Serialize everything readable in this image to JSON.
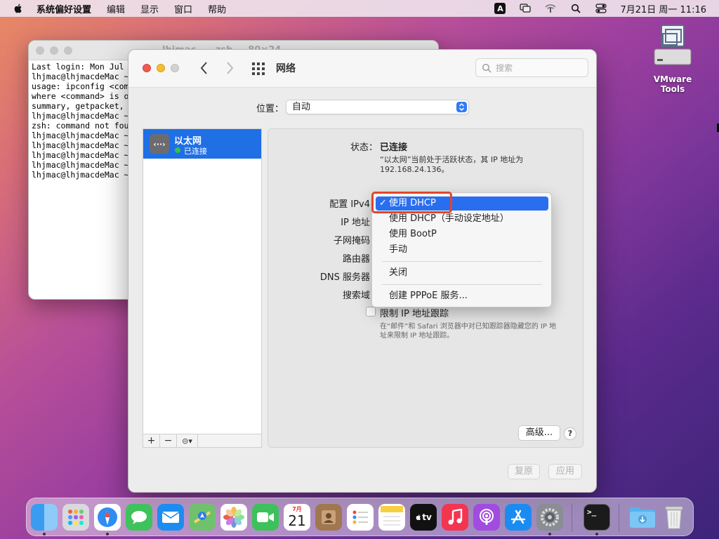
{
  "menubar": {
    "app_name": "系统偏好设置",
    "items": [
      "编辑",
      "显示",
      "窗口",
      "帮助"
    ],
    "input_method": "A",
    "clock": "7月21日 周一  11:16"
  },
  "desktop": {
    "vmware_label": "VMware Tools"
  },
  "terminal": {
    "title": "lhjmac — -zsh — 80×24",
    "lines": [
      "Last login: Mon Jul",
      "lhjmac@lhjmacdeMac ~",
      "usage: ipconfig <com",
      "where <command> is o",
      "summary, getpacket,",
      "lhjmac@lhjmacdeMac ~",
      "zsh: command not fou",
      "lhjmac@lhjmacdeMac ~",
      "lhjmac@lhjmacdeMac ~",
      "lhjmac@lhjmacdeMac ~",
      "lhjmac@lhjmacdeMac ~",
      "lhjmac@lhjmacdeMac ~"
    ]
  },
  "window": {
    "title": "网络",
    "search_placeholder": "搜索",
    "location_label": "位置：",
    "location_value": "自动",
    "service": {
      "name": "以太网",
      "status": "已连接",
      "icon_text": "‹··›"
    },
    "sidebar_buttons": [
      "+",
      "−",
      "⊝▾"
    ],
    "status_label": "状态：",
    "status_value": "已连接",
    "status_desc": "“以太网”当前处于活跃状态，其 IP 地址为 192.168.24.136。",
    "fields": {
      "configure_ipv4": "配置 IPv4",
      "ip_address": "IP 地址",
      "subnet_mask": "子网掩码",
      "router": "路由器",
      "dns_server": "DNS 服务器",
      "search_domains": "搜索域"
    },
    "limit_ip_tracking": "限制 IP 地址跟踪",
    "limit_ip_tracking_desc": "在“邮件”和 Safari 浏览器中对已知跟踪器隐藏您的 IP 地址来限制 IP 地址跟踪。",
    "advanced_button": "高级...",
    "help_button": "?",
    "revert_button": "复原",
    "apply_button": "应用"
  },
  "dropdown": {
    "check": "✓",
    "items": [
      "使用 DHCP",
      "使用 DHCP（手动设定地址）",
      "使用 BootP",
      "手动",
      "关闭",
      "创建 PPPoE 服务..."
    ],
    "selected": "使用 DHCP"
  },
  "dock": {
    "calendar_month": "7月",
    "calendar_day": "21",
    "tv_label": "tv",
    "terminal_prompt": ">_"
  },
  "colors": {
    "accent": "#1f6fe5",
    "highlight_box": "#e2452c",
    "status_green": "#38c24a"
  }
}
